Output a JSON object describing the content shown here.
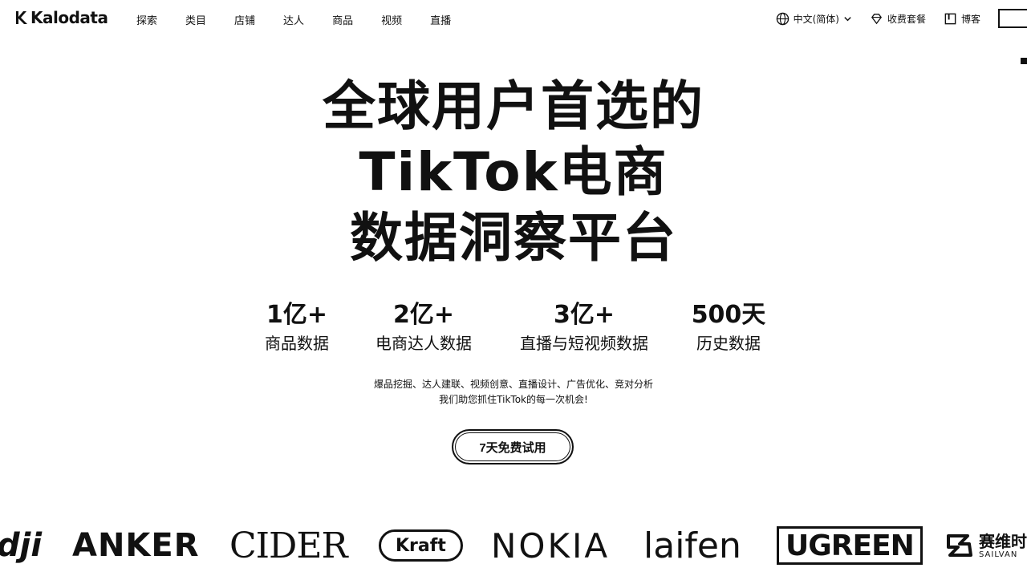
{
  "nav": {
    "logo_text": "Kalodata",
    "links": [
      "探索",
      "类目",
      "店铺",
      "达人",
      "商品",
      "视频",
      "直播"
    ],
    "language": "中文(简体)",
    "pricing": "收费套餐",
    "blog": "博客"
  },
  "hero": {
    "line1": "全球用户首选的",
    "line2": "TikTok电商",
    "line3": "数据洞察平台"
  },
  "stats": [
    {
      "value": "1亿+",
      "label": "商品数据"
    },
    {
      "value": "2亿+",
      "label": "电商达人数据"
    },
    {
      "value": "3亿+",
      "label": "直播与短视频数据"
    },
    {
      "value": "500天",
      "label": "历史数据"
    }
  ],
  "tagline": {
    "line1": "爆品挖掘、达人建联、视频创意、直播设计、广告优化、竞对分析",
    "line2": "我们助您抓住TikTok的每一次机会!"
  },
  "cta_label": "7天免费试用",
  "brands": {
    "dji": "dji",
    "anker": "ANKER",
    "cider": "CIDER",
    "kraft": "Kraft",
    "nokia": "NOKIA",
    "laifen": "laifen",
    "ugreen": "UGREEN",
    "sailvan_cn": "赛维时",
    "sailvan_en": "SAILVAN"
  },
  "icons": {
    "language": "globe-icon",
    "language_caret": "chevron-down-icon",
    "pricing": "diamond-icon",
    "blog": "book-icon"
  }
}
